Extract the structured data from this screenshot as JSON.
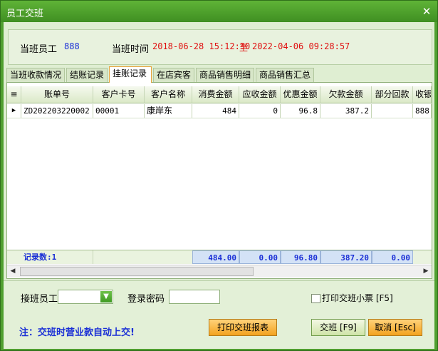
{
  "window": {
    "title": "员工交班",
    "close_symbol": "✕"
  },
  "info": {
    "staff_label": "当班员工",
    "staff_value": "888",
    "time_label": "当班时间",
    "time_start": "2018-06-28 15:12:30",
    "time_sep": "至",
    "time_end": "2022-04-06 09:28:57"
  },
  "tabs": [
    {
      "label": "当班收款情况"
    },
    {
      "label": "结账记录"
    },
    {
      "label": "挂账记录"
    },
    {
      "label": "在店宾客"
    },
    {
      "label": "商品销售明细"
    },
    {
      "label": "商品销售汇总"
    }
  ],
  "grid": {
    "columns": [
      "账单号",
      "客户卡号",
      "客户名称",
      "消费金额",
      "应收金额",
      "优惠金额",
      "欠款金额",
      "部分回款",
      "收银"
    ],
    "row_indicator": "▶",
    "rows": [
      [
        "ZD202203220002",
        "00001",
        "康岸东",
        "484",
        "0",
        "96.8",
        "387.2",
        "",
        "888"
      ]
    ],
    "footer": {
      "record_label": "记录数:1",
      "totals": [
        "484.00",
        "0.00",
        "96.80",
        "387.20",
        "0.00"
      ]
    }
  },
  "bottom": {
    "handover_label": "接班员工",
    "handover_value": "",
    "password_label": "登录密码",
    "password_value": "",
    "print_ticket_label": "打印交班小票 [F5]",
    "note": "注：交班时营业款自动上交!",
    "print_report_button": "打印交班报表",
    "confirm_button": "交班 [F9]",
    "cancel_button": "取消 [Esc]"
  },
  "colors": {
    "title_bar": "#4f9f2f",
    "accent_blue": "#1a2fd6",
    "accent_red": "#e01010",
    "button_orange": "#f3a21f"
  }
}
